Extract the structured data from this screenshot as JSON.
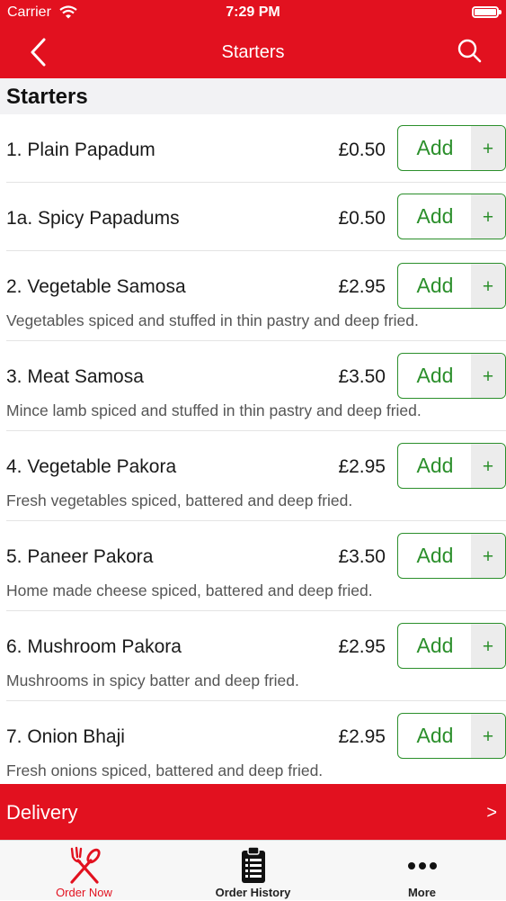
{
  "status_bar": {
    "carrier": "Carrier",
    "time": "7:29 PM"
  },
  "nav": {
    "title": "Starters",
    "back_icon": "chevron-left-icon",
    "search_icon": "search-icon"
  },
  "section": {
    "title": "Starters"
  },
  "add_button": {
    "label": "Add",
    "plus": "+"
  },
  "items": [
    {
      "name": "1. Plain Papadum",
      "price": "£0.50",
      "description": ""
    },
    {
      "name": "1a. Spicy Papadums",
      "price": "£0.50",
      "description": ""
    },
    {
      "name": "2. Vegetable Samosa",
      "price": "£2.95",
      "description": "Vegetables spiced and stuffed in thin pastry and deep fried."
    },
    {
      "name": "3. Meat Samosa",
      "price": "£3.50",
      "description": "Mince lamb spiced and stuffed in thin pastry and deep fried."
    },
    {
      "name": "4. Vegetable Pakora",
      "price": "£2.95",
      "description": "Fresh vegetables spiced, battered and deep fried."
    },
    {
      "name": "5. Paneer Pakora",
      "price": "£3.50",
      "description": "Home made cheese spiced, battered and deep fried."
    },
    {
      "name": "6. Mushroom Pakora",
      "price": "£2.95",
      "description": "Mushrooms in spicy batter and deep fried."
    },
    {
      "name": "7. Onion Bhaji",
      "price": "£2.95",
      "description": "Fresh onions spiced, battered and deep fried."
    }
  ],
  "delivery": {
    "label": "Delivery",
    "chevron": ">"
  },
  "tabs": [
    {
      "label": "Order Now",
      "icon": "fork-knife-icon",
      "active": true
    },
    {
      "label": "Order History",
      "icon": "clipboard-icon",
      "active": false
    },
    {
      "label": "More",
      "icon": "more-dots-icon",
      "active": false
    }
  ],
  "colors": {
    "brand_red": "#e2111f",
    "add_green": "#2b8f2b"
  }
}
